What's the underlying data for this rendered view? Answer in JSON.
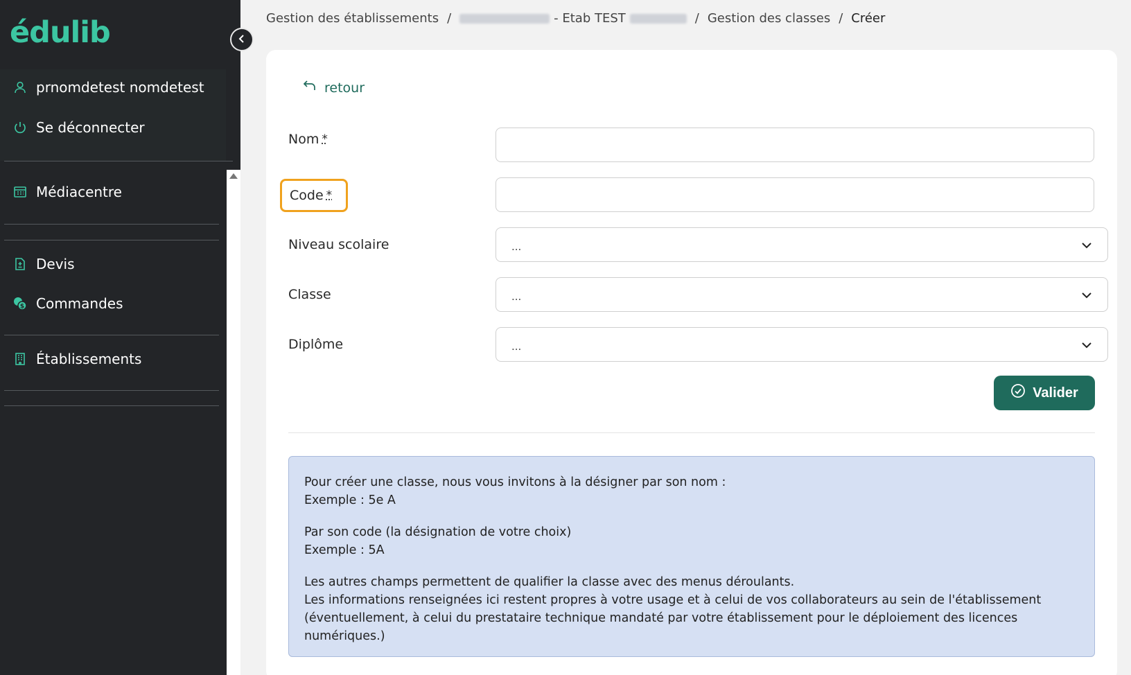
{
  "brand": {
    "name": "édulib",
    "color": "#3cc6a2"
  },
  "colors": {
    "sidebar_bg": "#232528",
    "primary": "#1f6b5c",
    "focus_outline": "#f0a21e",
    "info_bg": "#d6e0f3"
  },
  "sidebar": {
    "user_name": "prnomdetest nomdetest",
    "logout": "Se déconnecter",
    "items": [
      {
        "label": "Médiacentre",
        "icon": "mediacentre-icon"
      },
      {
        "label": "Devis",
        "icon": "document-plus-minus-icon"
      },
      {
        "label": "Commandes",
        "icon": "coins-icon"
      },
      {
        "label": "Établissements",
        "icon": "building-icon"
      }
    ]
  },
  "breadcrumb": {
    "item1": "Gestion des établissements",
    "item2_mid": "- Etab TEST",
    "item3": "Gestion des classes",
    "item4": "Créer",
    "separator": "/"
  },
  "form": {
    "back": "retour",
    "nom_label": "Nom",
    "code_label": "Code",
    "required_mark": "*",
    "nom_value": "",
    "code_value": "",
    "niveau_label": "Niveau scolaire",
    "niveau_value": "...",
    "classe_label": "Classe",
    "classe_value": "...",
    "diplome_label": "Diplôme",
    "diplome_value": "...",
    "submit": "Valider"
  },
  "info": {
    "p1_line1": "Pour créer une classe, nous vous invitons à la désigner par son nom :",
    "p1_line2": "Exemple : 5e A",
    "p2_line1": "Par son code (la désignation de votre choix)",
    "p2_line2": "Exemple : 5A",
    "p3_line1": "Les autres champs permettent de qualifier la classe avec des menus déroulants.",
    "p3_line2": "Les informations renseignées ici restent propres à votre usage et à celui de vos collaborateurs au sein de l'établissement (éventuellement, à celui du prestataire technique mandaté par votre établissement pour le déploiement des licences numériques.)"
  }
}
